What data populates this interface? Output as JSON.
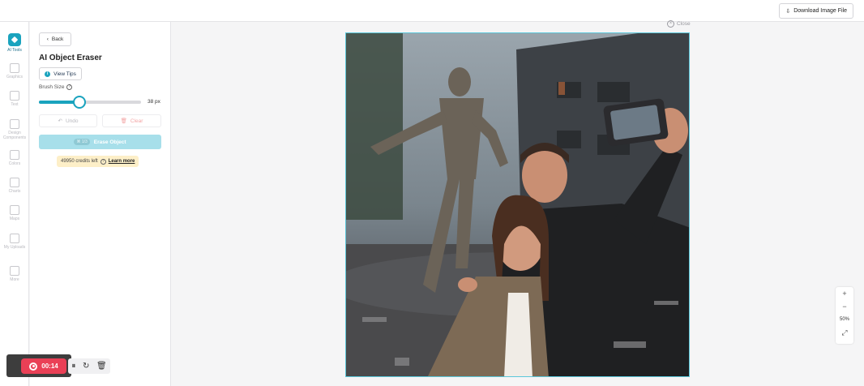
{
  "topbar": {
    "download_label": "Download Image File",
    "download_icon": "download-icon"
  },
  "rail": {
    "items": [
      {
        "label": "AI Tools",
        "icon": "sparkle-icon",
        "active": true
      },
      {
        "label": "Graphics",
        "icon": "graphics-icon"
      },
      {
        "label": "Text",
        "icon": "text-icon"
      },
      {
        "label": "Design Components",
        "icon": "components-icon"
      },
      {
        "label": "Colors",
        "icon": "palette-icon"
      },
      {
        "label": "Charts",
        "icon": "chart-icon"
      },
      {
        "label": "Maps",
        "icon": "map-icon"
      },
      {
        "label": "My Uploads",
        "icon": "folder-icon"
      },
      {
        "label": "More",
        "icon": "grid-icon"
      }
    ]
  },
  "panel": {
    "back_label": "Back",
    "title": "AI Object Eraser",
    "tips_label": "View Tips",
    "brush_label": "Brush Size",
    "brush_value": "38",
    "brush_unit": "px",
    "brush_fraction": 0.4,
    "undo_label": "Undo",
    "clear_label": "Clear",
    "erase_shortcut": "⌘ 1/3",
    "erase_label": "Erase Object",
    "credits_text": "49950 credits left",
    "learn_more": "Learn more"
  },
  "canvas": {
    "close_label": "Close",
    "zoom_in": "+",
    "zoom_out": "−",
    "zoom_level": "50%",
    "fit_icon": "⤢"
  },
  "recorder": {
    "time": "00:14",
    "pause_icon": "⏸",
    "restart_icon": "↻",
    "delete_icon": "🗑"
  },
  "colors": {
    "accent": "#1aa3be",
    "record": "#ea4056",
    "credits_bg": "#fdefc8"
  }
}
